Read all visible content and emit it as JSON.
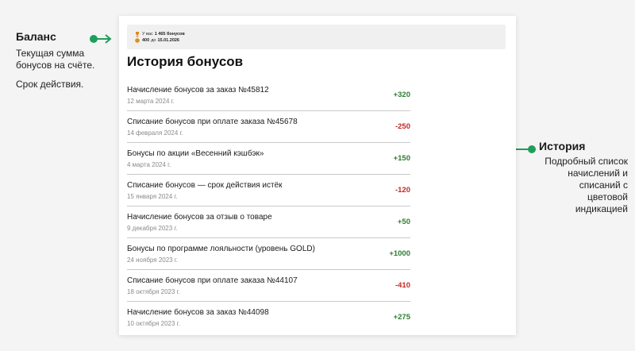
{
  "annotations": {
    "balance": {
      "title": "Баланс",
      "text1": "Текущая сумма бонусов на счёте.",
      "text2": "Срок действия."
    },
    "history": {
      "title": "История",
      "text": "Подробный список начислений и списаний с цветовой индикацией"
    },
    "arrow_color": "#1f9d5b"
  },
  "balance_bar": {
    "line1_prefix": "У вас",
    "line1_amount": "1 465 бонусов",
    "line2_amount": "400",
    "line2_suffix": "до",
    "line2_date": "15.01.2026"
  },
  "page_title": "История бонусов",
  "history": [
    {
      "title": "Начисление бонусов за заказ №45812",
      "date": "12 марта 2024 г.",
      "amount": "+320",
      "type": "plus"
    },
    {
      "title": "Списание бонусов при оплате заказа №45678",
      "date": "14 февраля 2024 г.",
      "amount": "-250",
      "type": "minus"
    },
    {
      "title": "Бонусы по акции «Весенний кэшбэк»",
      "date": "4 марта 2024 г.",
      "amount": "+150",
      "type": "plus"
    },
    {
      "title": "Списание бонусов — срок действия истёк",
      "date": "15 января 2024 г.",
      "amount": "-120",
      "type": "minus"
    },
    {
      "title": "Начисление бонусов за отзыв о товаре",
      "date": "9 декабря 2023 г.",
      "amount": "+50",
      "type": "plus"
    },
    {
      "title": "Бонусы по программе лояльности (уровень GOLD)",
      "date": "24 ноября 2023 г.",
      "amount": "+1000",
      "type": "plus"
    },
    {
      "title": "Списание бонусов при оплате заказа №44107",
      "date": "18 октября 2023 г.",
      "amount": "-410",
      "type": "minus"
    },
    {
      "title": "Начисление бонусов за заказ №44098",
      "date": "10 октября 2023 г.",
      "amount": "+275",
      "type": "plus"
    }
  ],
  "colors": {
    "plus": "#2e7d32",
    "minus": "#c62828",
    "arrow": "#1f9d5b"
  }
}
